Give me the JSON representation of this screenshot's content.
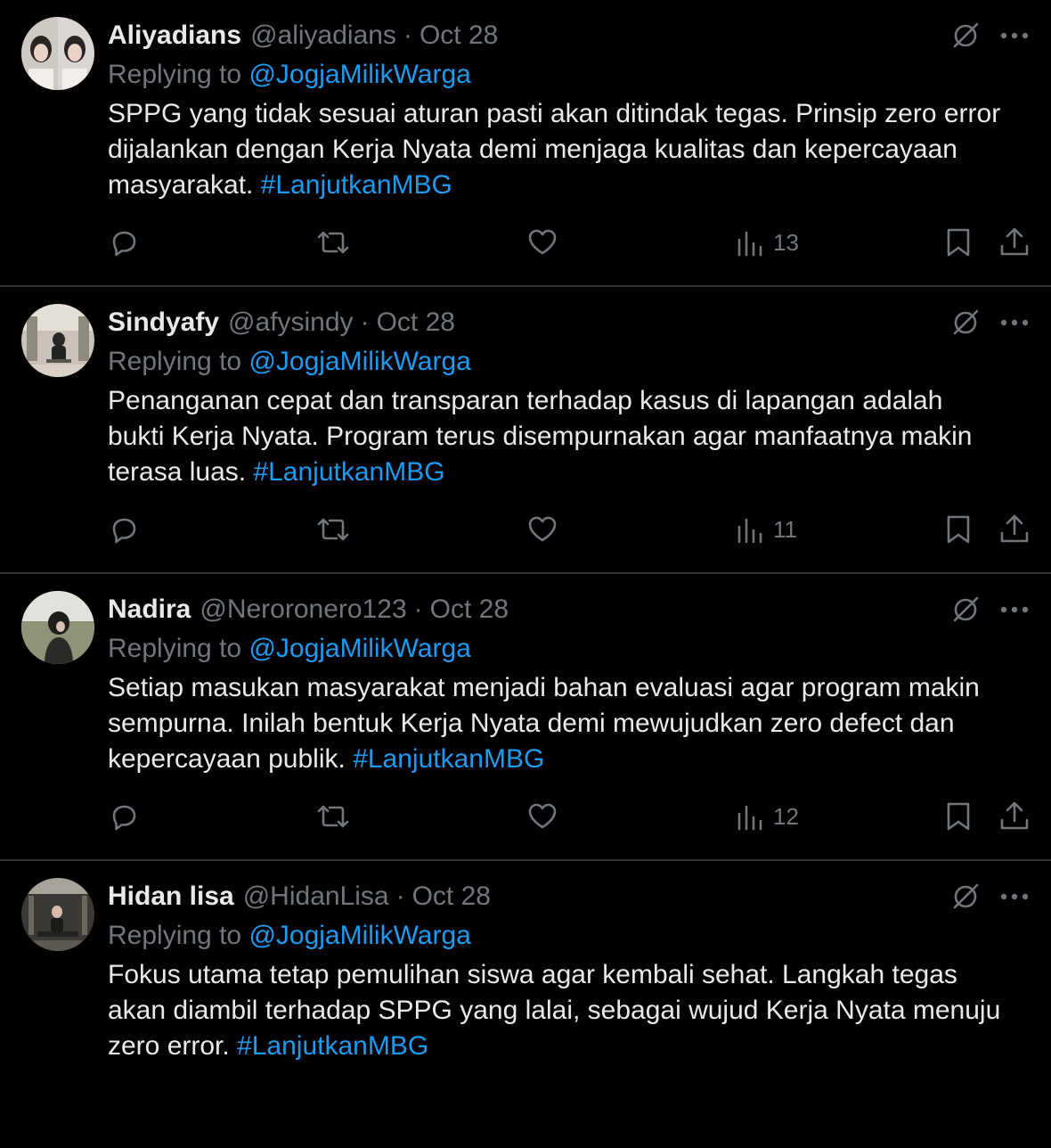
{
  "colors": {
    "background": "#000000",
    "text": "#e7e9ea",
    "muted": "#71767b",
    "accent": "#1d9bf0",
    "divider": "#2f3336"
  },
  "icons": {
    "reply": "reply-icon",
    "retweet": "retweet-icon",
    "like": "like-icon",
    "views": "views-icon",
    "bookmark": "bookmark-icon",
    "share": "share-icon",
    "grok": "grok-icon",
    "more": "more-icon"
  },
  "tweets": [
    {
      "name": "Aliyadians",
      "handle": "@aliyadians",
      "separator": "·",
      "date": "Oct 28",
      "replying_prefix": "Replying to",
      "replying_to": "@JogjaMilikWarga",
      "lines": [
        "SPPG yang tidak sesuai aturan pasti akan ditindak tegas. Prinsip zero error",
        "dijalankan dengan Kerja Nyata demi menjaga kualitas dan kepercayaan",
        "masyarakat."
      ],
      "hashtag": "#LanjutkanMBG",
      "views": "13"
    },
    {
      "name": "Sindyafy",
      "handle": "@afysindy",
      "separator": "·",
      "date": "Oct 28",
      "replying_prefix": "Replying to",
      "replying_to": "@JogjaMilikWarga",
      "lines": [
        "Penanganan cepat dan transparan terhadap kasus di lapangan adalah",
        "bukti Kerja Nyata. Program terus disempurnakan agar manfaatnya makin",
        "terasa luas."
      ],
      "hashtag": "#LanjutkanMBG",
      "views": "11"
    },
    {
      "name": "Nadira",
      "handle": "@Neroronero123",
      "separator": "·",
      "date": "Oct 28",
      "replying_prefix": "Replying to",
      "replying_to": "@JogjaMilikWarga",
      "lines": [
        "Setiap masukan masyarakat menjadi bahan evaluasi agar program makin",
        "sempurna. Inilah bentuk Kerja Nyata demi mewujudkan zero defect dan",
        "kepercayaan publik."
      ],
      "hashtag": "#LanjutkanMBG",
      "views": "12"
    },
    {
      "name": "Hidan lisa",
      "handle": "@HidanLisa",
      "separator": "·",
      "date": "Oct 28",
      "replying_prefix": "Replying to",
      "replying_to": "@JogjaMilikWarga",
      "lines": [
        "Fokus utama tetap pemulihan siswa agar kembali sehat. Langkah tegas",
        "akan diambil terhadap SPPG yang lalai, sebagai wujud Kerja Nyata menuju",
        "zero error."
      ],
      "hashtag": "#LanjutkanMBG",
      "views": ""
    }
  ]
}
